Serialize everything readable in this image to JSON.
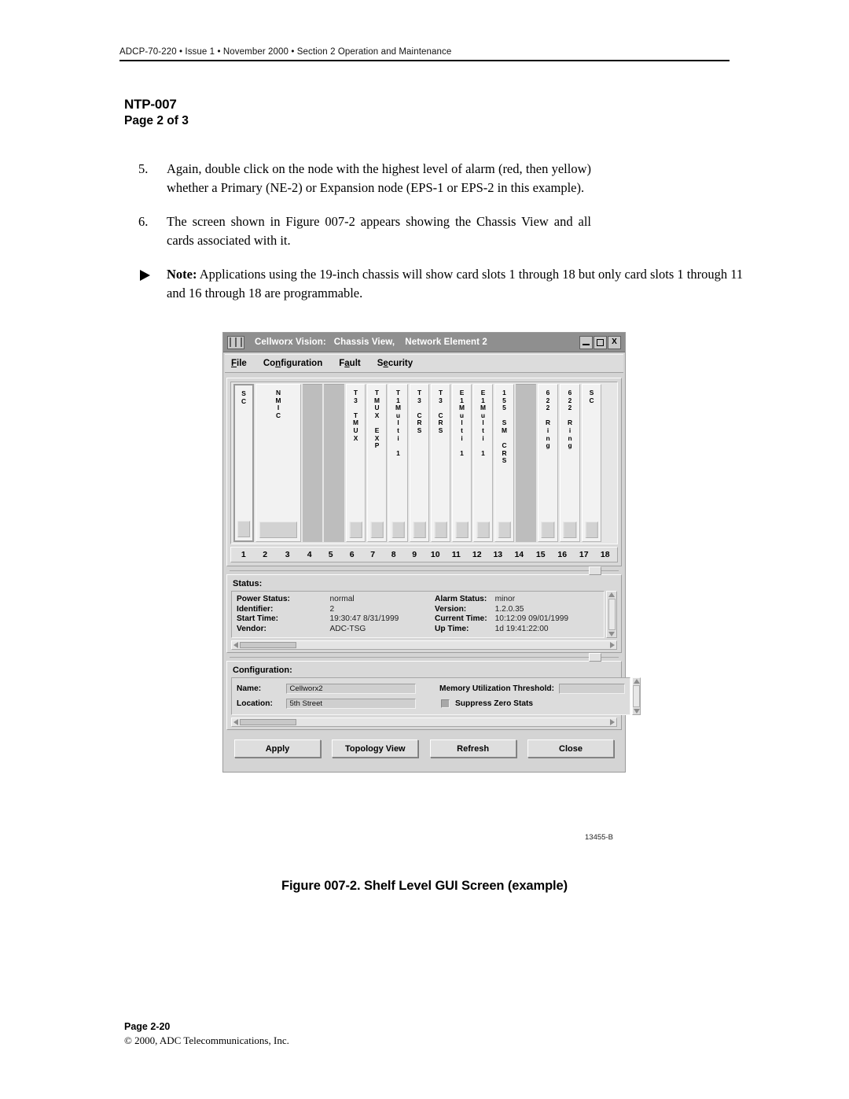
{
  "header": {
    "running_head": "ADCP-70-220 • Issue 1 • November 2000 • Section 2 Operation and Maintenance"
  },
  "title_block": {
    "ntp": "NTP-007",
    "page_of": "Page 2 of 3"
  },
  "steps": [
    {
      "number": "5.",
      "text": "Again, double click on the node with the highest level of alarm (red, then yellow) whether a Primary (NE-2) or Expansion node (EPS-1 or EPS-2 in this example)."
    },
    {
      "number": "6.",
      "text": "The screen shown in Figure 007-2 appears showing the Chassis View and all cards associated with it."
    }
  ],
  "note": {
    "label": "Note:",
    "text": " Applications  using the 19-inch chassis will show card slots 1 through 18 but only card slots 1 through 11 and 16 through 18 are programmable."
  },
  "gui": {
    "title": "Cellworx Vision:   Chassis View,    Network Element 2",
    "window_buttons": [
      {
        "name": "minimize-button",
        "glyph": "minimize-icon"
      },
      {
        "name": "maximize-button",
        "glyph": "maximize-icon"
      },
      {
        "name": "close-button",
        "glyph": "X"
      }
    ],
    "menus": [
      {
        "label": "File",
        "mnemonic": "F"
      },
      {
        "label": "Configuration",
        "mnemonic": "n"
      },
      {
        "label": "Fault",
        "mnemonic": "a"
      },
      {
        "label": "Security",
        "mnemonic": "e"
      }
    ],
    "chassis": {
      "cards": [
        {
          "label": "S\nC",
          "slots": [
            "1"
          ],
          "empty": false,
          "style": "sc"
        },
        {
          "label": "N\nM\nI\nC",
          "slots": [
            "2",
            "3"
          ],
          "empty": false,
          "style": "wide"
        },
        {
          "label": "",
          "slots": [
            "4"
          ],
          "empty": true,
          "style": ""
        },
        {
          "label": "",
          "slots": [
            "5"
          ],
          "empty": true,
          "style": ""
        },
        {
          "label": "T\n3\n\nT\nM\nU\nX",
          "slots": [
            "6"
          ],
          "empty": false,
          "style": ""
        },
        {
          "label": "T\nM\nU\nX\n\nE\nX\nP",
          "slots": [
            "7"
          ],
          "empty": false,
          "style": ""
        },
        {
          "label": "T\n1\nM\nu\nl\nt\ni\n\n1",
          "slots": [
            "8"
          ],
          "empty": false,
          "style": ""
        },
        {
          "label": "T\n3\n\nC\nR\nS",
          "slots": [
            "9"
          ],
          "empty": false,
          "style": ""
        },
        {
          "label": "T\n3\n\nC\nR\nS",
          "slots": [
            "10"
          ],
          "empty": false,
          "style": ""
        },
        {
          "label": "E\n1\nM\nu\nl\nt\ni\n\n1",
          "slots": [
            "11"
          ],
          "empty": false,
          "style": ""
        },
        {
          "label": "E\n1\nM\nu\nl\nt\ni\n\n1",
          "slots": [
            "12"
          ],
          "empty": false,
          "style": ""
        },
        {
          "label": "1\n5\n5\n\nS\nM\n\nC\nR\nS",
          "slots": [
            "13"
          ],
          "empty": false,
          "style": ""
        },
        {
          "label": "",
          "slots": [
            "14"
          ],
          "empty": true,
          "style": ""
        },
        {
          "label": "6\n2\n2\n\nR\ni\nn\ng",
          "slots": [
            "15"
          ],
          "empty": false,
          "style": ""
        },
        {
          "label": "6\n2\n2\n\nR\ni\nn\ng",
          "slots": [
            "16"
          ],
          "empty": false,
          "style": ""
        },
        {
          "label": "S\nC",
          "slots": [
            "17"
          ],
          "empty": false,
          "style": ""
        }
      ],
      "slot_numbers": [
        "1",
        "2",
        "3",
        "4",
        "5",
        "6",
        "7",
        "8",
        "9",
        "10",
        "11",
        "12",
        "13",
        "14",
        "15",
        "16",
        "17",
        "18"
      ]
    },
    "status_panel": {
      "title": "Status:",
      "left": [
        {
          "key": "Power Status:",
          "value": "normal"
        },
        {
          "key": "Identifier:",
          "value": "2"
        },
        {
          "key": "Start Time:",
          "value": "19:30:47 8/31/1999"
        },
        {
          "key": "Vendor:",
          "value": "ADC-TSG"
        }
      ],
      "right": [
        {
          "key": "Alarm Status:",
          "value": "minor"
        },
        {
          "key": "Version:",
          "value": "1.2.0.35"
        },
        {
          "key": "Current Time:",
          "value": "10:12:09 09/01/1999"
        },
        {
          "key": "Up Time:",
          "value": "1d 19:41:22:00"
        }
      ]
    },
    "configuration_panel": {
      "title": "Configuration:",
      "name_label": "Name:",
      "name_value": "Cellworx2",
      "location_label": "Location:",
      "location_value": "5th Street",
      "memory_label": "Memory Utilization Threshold:",
      "memory_value": "",
      "suppress_label": "Suppress Zero Stats"
    },
    "buttons": [
      {
        "label": "Apply"
      },
      {
        "label": "Topology View"
      },
      {
        "label": "Refresh"
      },
      {
        "label": "Close"
      }
    ]
  },
  "figure": {
    "id": "13455-B",
    "caption": "Figure 007-2. Shelf Level GUI Screen (example)"
  },
  "footer": {
    "page": "Page 2-20",
    "copyright": "© 2000, ADC Telecommunications, Inc."
  }
}
